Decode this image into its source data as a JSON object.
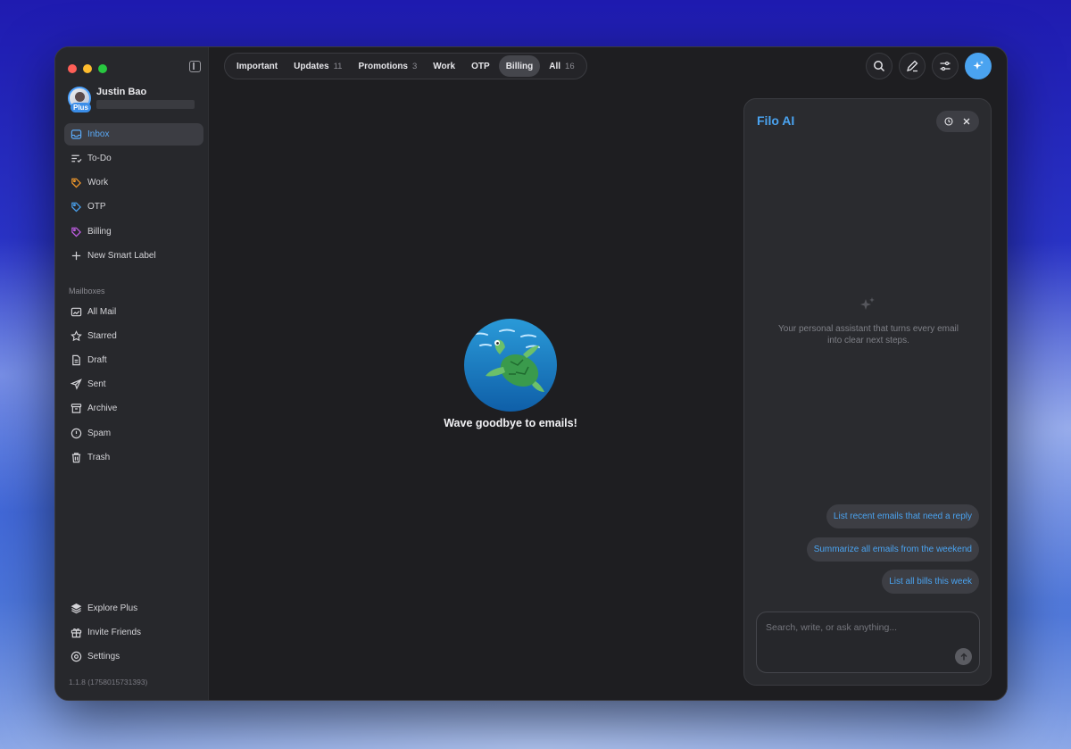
{
  "profile": {
    "name": "Justin Bao",
    "plan_badge": "Plus"
  },
  "sidebar": {
    "items": [
      {
        "label": "Inbox",
        "icon": "inbox-icon",
        "active": true
      },
      {
        "label": "To-Do",
        "icon": "todo-icon"
      },
      {
        "label": "Work",
        "icon": "tag-icon",
        "color": "#f39a2b"
      },
      {
        "label": "OTP",
        "icon": "tag-icon",
        "color": "#4aa3f0"
      },
      {
        "label": "Billing",
        "icon": "tag-icon",
        "color": "#c25ee6"
      },
      {
        "label": "New Smart Label",
        "icon": "plus-icon"
      }
    ],
    "mailboxes_title": "Mailboxes",
    "mailboxes": [
      {
        "label": "All Mail",
        "icon": "all-mail-icon"
      },
      {
        "label": "Starred",
        "icon": "star-icon"
      },
      {
        "label": "Draft",
        "icon": "draft-icon"
      },
      {
        "label": "Sent",
        "icon": "send-icon"
      },
      {
        "label": "Archive",
        "icon": "archive-icon"
      },
      {
        "label": "Spam",
        "icon": "spam-icon"
      },
      {
        "label": "Trash",
        "icon": "trash-icon"
      }
    ],
    "bottom": [
      {
        "label": "Explore Plus",
        "icon": "layers-icon"
      },
      {
        "label": "Invite Friends",
        "icon": "gift-icon"
      },
      {
        "label": "Settings",
        "icon": "settings-icon"
      }
    ],
    "version": "1.1.8 (1758015731393)"
  },
  "tabs": [
    {
      "label": "Important",
      "count": ""
    },
    {
      "label": "Updates",
      "count": "11"
    },
    {
      "label": "Promotions",
      "count": "3"
    },
    {
      "label": "Work",
      "count": ""
    },
    {
      "label": "OTP",
      "count": ""
    },
    {
      "label": "Billing",
      "count": "",
      "active": true
    },
    {
      "label": "All",
      "count": "16"
    }
  ],
  "empty_state": {
    "message": "Wave goodbye to emails!"
  },
  "ai": {
    "title": "Filo AI",
    "description": "Your personal assistant that turns every email into clear next steps.",
    "suggestions": [
      "List recent emails that need a reply",
      "Summarize all emails from the weekend",
      "List all bills this week"
    ],
    "input_placeholder": "Search, write, or ask anything..."
  },
  "colors": {
    "accent": "#4aa3f0",
    "work": "#f39a2b",
    "billing": "#c25ee6"
  }
}
